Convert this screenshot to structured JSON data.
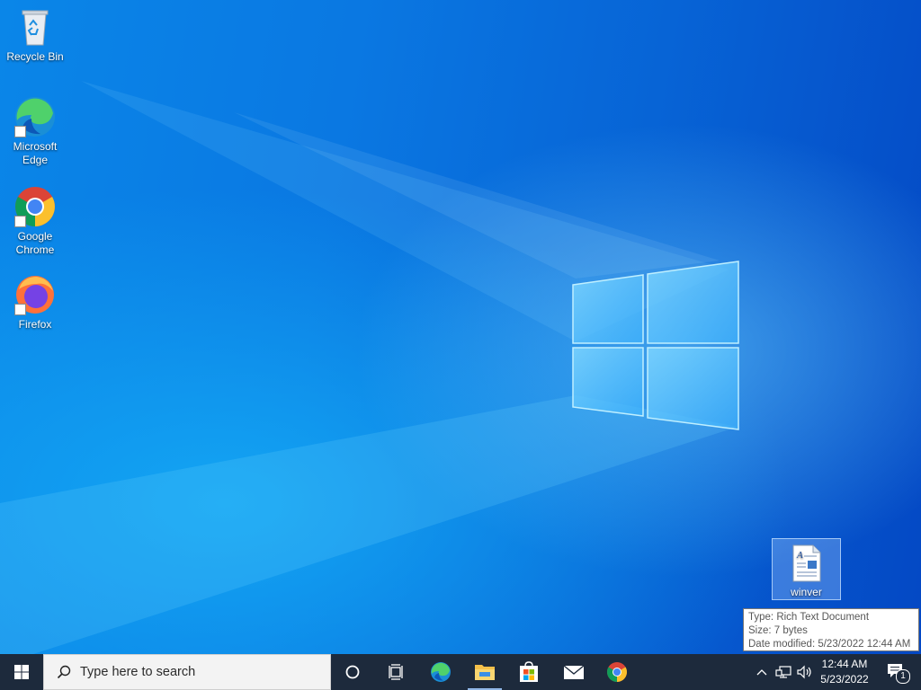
{
  "desktop": {
    "icons": [
      {
        "id": "recycle-bin",
        "label": "Recycle Bin"
      },
      {
        "id": "edge",
        "label": "Microsoft Edge"
      },
      {
        "id": "chrome",
        "label": "Google Chrome"
      },
      {
        "id": "firefox",
        "label": "Firefox"
      }
    ],
    "selected_file": {
      "label": "winver",
      "icon": "rich-text-document-icon"
    },
    "tooltip": {
      "type": "Type: Rich Text Document",
      "size": "Size: 7 bytes",
      "modified": "Date modified: 5/23/2022 12:44 AM"
    }
  },
  "taskbar": {
    "search_placeholder": "Type here to search",
    "pinned": [
      "cortana-icon",
      "task-view-icon",
      "edge-icon",
      "file-explorer-icon",
      "store-icon",
      "mail-icon",
      "chrome-icon"
    ],
    "tray": {
      "time": "12:44 AM",
      "date": "5/23/2022",
      "notification_count": "1"
    }
  },
  "colors": {
    "accent": "#0a78e2",
    "taskbar": "#1d2a3c"
  }
}
